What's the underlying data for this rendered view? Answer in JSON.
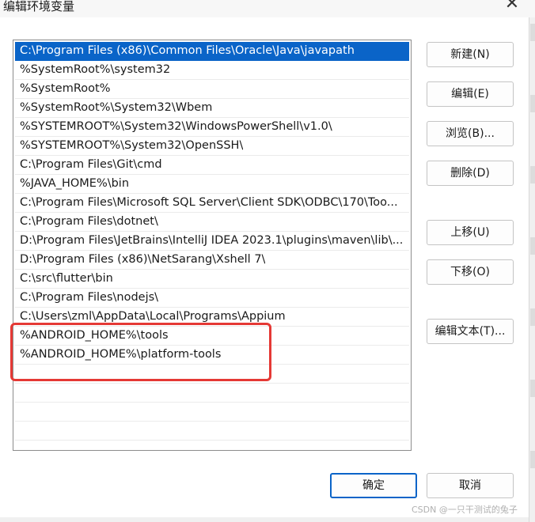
{
  "window": {
    "title": "编辑环境变量",
    "close_glyph": "✕"
  },
  "path_list": {
    "items": [
      "C:\\Program Files (x86)\\Common Files\\Oracle\\Java\\javapath",
      "%SystemRoot%\\system32",
      "%SystemRoot%",
      "%SystemRoot%\\System32\\Wbem",
      "%SYSTEMROOT%\\System32\\WindowsPowerShell\\v1.0\\",
      "%SYSTEMROOT%\\System32\\OpenSSH\\",
      "C:\\Program Files\\Git\\cmd",
      "%JAVA_HOME%\\bin",
      "C:\\Program Files\\Microsoft SQL Server\\Client SDK\\ODBC\\170\\Too...",
      "C:\\Program Files\\dotnet\\",
      "D:\\Program Files\\JetBrains\\IntelliJ IDEA 2023.1\\plugins\\maven\\lib\\...",
      "D:\\Program Files (x86)\\NetSarang\\Xshell 7\\",
      "C:\\src\\flutter\\bin",
      "C:\\Program Files\\nodejs\\",
      "C:\\Users\\zml\\AppData\\Local\\Programs\\Appium",
      "%ANDROID_HOME%\\tools",
      "%ANDROID_HOME%\\platform-tools"
    ],
    "selected_index": 0,
    "empty_rows": 4
  },
  "buttons": {
    "new": "新建(N)",
    "edit": "编辑(E)",
    "browse": "浏览(B)...",
    "delete": "删除(D)",
    "move_up": "上移(U)",
    "move_down": "下移(O)",
    "edit_text": "编辑文本(T)...",
    "ok": "确定",
    "cancel": "取消"
  },
  "watermark": "CSDN @一只干测试的兔子",
  "colors": {
    "selection": "#0a64c8",
    "annotation": "#e53935"
  }
}
